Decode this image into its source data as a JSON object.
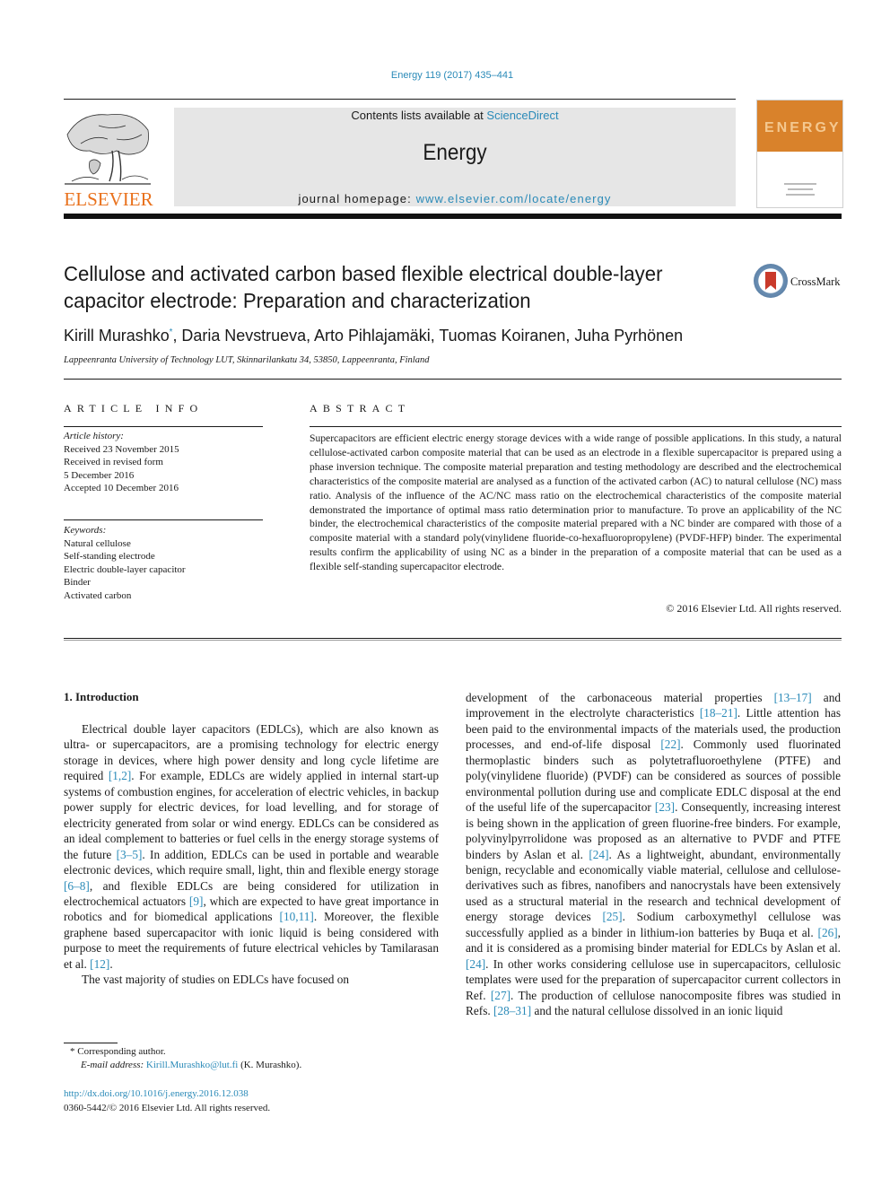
{
  "header": {
    "citation": "Energy 119 (2017) 435–441",
    "contents_prefix": "Contents lists available at ",
    "contents_link": "ScienceDirect",
    "journal_name": "Energy",
    "homepage_prefix": "journal homepage: ",
    "homepage_link": "www.elsevier.com/locate/energy",
    "publisher_logo": "ELSEVIER",
    "cover_title": "ENERGY",
    "brand_color": "#e9711c",
    "link_color": "#2a8ab8",
    "cover_color": "#d9822b"
  },
  "article": {
    "title": "Cellulose and activated carbon based flexible electrical double-layer capacitor electrode: Preparation and characterization",
    "crossmark_label": "CrossMark",
    "authors": [
      {
        "name": "Kirill Murashko",
        "mark": "*"
      },
      {
        "name": "Daria Nevstrueva"
      },
      {
        "name": "Arto Pihlajamäki"
      },
      {
        "name": "Tuomas Koiranen"
      },
      {
        "name": "Juha Pyrhönen"
      }
    ],
    "affiliation": "Lappeenranta University of Technology LUT, Skinnarilankatu 34, 53850, Lappeenranta, Finland"
  },
  "article_info": {
    "heading": "ARTICLE INFO",
    "history_label": "Article history:",
    "history": [
      "Received 23 November 2015",
      "Received in revised form",
      "5 December 2016",
      "Accepted 10 December 2016"
    ],
    "keywords_label": "Keywords:",
    "keywords": [
      "Natural cellulose",
      "Self-standing electrode",
      "Electric double-layer capacitor",
      "Binder",
      "Activated carbon"
    ]
  },
  "abstract": {
    "heading": "ABSTRACT",
    "text": "Supercapacitors are efficient electric energy storage devices with a wide range of possible applications. In this study, a natural cellulose-activated carbon composite material that can be used as an electrode in a flexible supercapacitor is prepared using a phase inversion technique. The composite material preparation and testing methodology are described and the electrochemical characteristics of the composite material are analysed as a function of the activated carbon (AC) to natural cellulose (NC) mass ratio. Analysis of the influence of the AC/NC mass ratio on the electrochemical characteristics of the composite material demonstrated the importance of optimal mass ratio determination prior to manufacture. To prove an applicability of the NC binder, the electrochemical characteristics of the composite material prepared with a NC binder are compared with those of a composite material with a standard poly(vinylidene fluoride-co-hexafluoropropylene) (PVDF-HFP) binder. The experimental results confirm the applicability of using NC as a binder in the preparation of a composite material that can be used as a flexible self-standing supercapacitor electrode.",
    "copyright": "© 2016 Elsevier Ltd. All rights reserved."
  },
  "body": {
    "section_heading": "1.  Introduction",
    "left_p1": [
      {
        "t": "Electrical double layer capacitors (EDLCs), which are also known as ultra- or supercapacitors, are a promising technology for electric energy storage in devices, where high power density and long cycle lifetime are required "
      },
      {
        "ref": "[1,2]"
      },
      {
        "t": ". For example, EDLCs are widely applied in internal start-up systems of combustion engines, for acceleration of electric vehicles, in backup power supply for electric devices, for load levelling, and for storage of electricity generated from solar or wind energy. EDLCs can be considered as an ideal complement to batteries or fuel cells in the energy storage systems of the future "
      },
      {
        "ref": "[3–5]"
      },
      {
        "t": ". In addition, EDLCs can be used in portable and wearable electronic devices, which require small, light, thin and flexible energy storage "
      },
      {
        "ref": "[6–8]"
      },
      {
        "t": ", and flexible EDLCs are being considered for utilization in electrochemical actuators "
      },
      {
        "ref": "[9]"
      },
      {
        "t": ", which are expected to have great importance in robotics and for biomedical applications "
      },
      {
        "ref": "[10,11]"
      },
      {
        "t": ". Moreover, the flexible graphene based supercapacitor with ionic liquid is being considered with purpose to meet the requirements of future electrical vehicles by Tamilarasan et al. "
      },
      {
        "ref": "[12]"
      },
      {
        "t": "."
      }
    ],
    "left_p2": "The vast majority of studies on EDLCs have focused on",
    "right_p": [
      {
        "t": "development of the carbonaceous material properties "
      },
      {
        "ref": "[13–17]"
      },
      {
        "t": " and improvement in the electrolyte characteristics "
      },
      {
        "ref": "[18–21]"
      },
      {
        "t": ". Little attention has been paid to the environmental impacts of the materials used, the production processes, and end-of-life disposal "
      },
      {
        "ref": "[22]"
      },
      {
        "t": ". Commonly used fluorinated thermoplastic binders such as polytetrafluoroethylene (PTFE) and poly(vinylidene fluoride) (PVDF) can be considered as sources of possible environmental pollution during use and complicate EDLC disposal at the end of the useful life of the supercapacitor "
      },
      {
        "ref": "[23]"
      },
      {
        "t": ". Consequently, increasing interest is being shown in the application of green fluorine-free binders. For example, polyvinylpyrrolidone was proposed as an alternative to PVDF and PTFE binders by Aslan et al. "
      },
      {
        "ref": "[24]"
      },
      {
        "t": ". As a lightweight, abundant, environmentally benign, recyclable and economically viable material, cellulose and cellulose-derivatives such as fibres, nanofibers and nanocrystals have been extensively used as a structural material in the research and technical development of energy storage devices "
      },
      {
        "ref": "[25]"
      },
      {
        "t": ". Sodium carboxymethyl cellulose was successfully applied as a binder in lithium-ion batteries by Buqa et al. "
      },
      {
        "ref": "[26]"
      },
      {
        "t": ", and it is considered as a promising binder material for EDLCs by Aslan et al. "
      },
      {
        "ref": "[24]"
      },
      {
        "t": ". In other works considering cellulose use in supercapacitors, cellulosic templates were used for the preparation of supercapacitor current collectors in Ref. "
      },
      {
        "ref": "[27]"
      },
      {
        "t": ". The production of cellulose nanocomposite fibres was studied in Refs. "
      },
      {
        "ref": "[28–31]"
      },
      {
        "t": " and the natural cellulose dissolved in an ionic liquid"
      }
    ]
  },
  "footnotes": {
    "corresponding_mark": "*",
    "corresponding_label": "Corresponding author.",
    "email_label": "E-mail address:",
    "email": "Kirill.Murashko@lut.fi",
    "email_suffix": " (K. Murashko).",
    "doi": "http://dx.doi.org/10.1016/j.energy.2016.12.038",
    "issn_line": "0360-5442/© 2016 Elsevier Ltd. All rights reserved."
  }
}
